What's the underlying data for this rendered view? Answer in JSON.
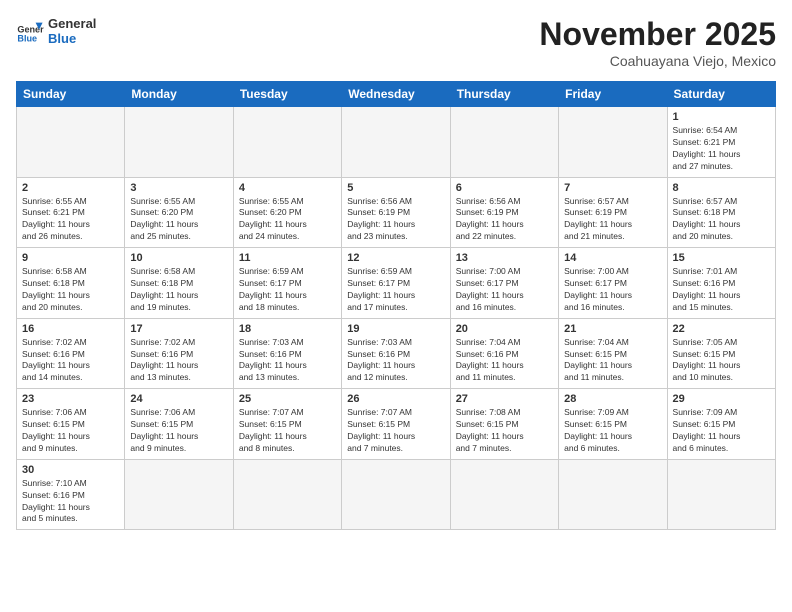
{
  "header": {
    "logo_general": "General",
    "logo_blue": "Blue",
    "month_title": "November 2025",
    "location": "Coahuayana Viejo, Mexico"
  },
  "days_of_week": [
    "Sunday",
    "Monday",
    "Tuesday",
    "Wednesday",
    "Thursday",
    "Friday",
    "Saturday"
  ],
  "weeks": [
    [
      {
        "day": "",
        "info": ""
      },
      {
        "day": "",
        "info": ""
      },
      {
        "day": "",
        "info": ""
      },
      {
        "day": "",
        "info": ""
      },
      {
        "day": "",
        "info": ""
      },
      {
        "day": "",
        "info": ""
      },
      {
        "day": "1",
        "info": "Sunrise: 6:54 AM\nSunset: 6:21 PM\nDaylight: 11 hours\nand 27 minutes."
      }
    ],
    [
      {
        "day": "2",
        "info": "Sunrise: 6:55 AM\nSunset: 6:21 PM\nDaylight: 11 hours\nand 26 minutes."
      },
      {
        "day": "3",
        "info": "Sunrise: 6:55 AM\nSunset: 6:20 PM\nDaylight: 11 hours\nand 25 minutes."
      },
      {
        "day": "4",
        "info": "Sunrise: 6:55 AM\nSunset: 6:20 PM\nDaylight: 11 hours\nand 24 minutes."
      },
      {
        "day": "5",
        "info": "Sunrise: 6:56 AM\nSunset: 6:19 PM\nDaylight: 11 hours\nand 23 minutes."
      },
      {
        "day": "6",
        "info": "Sunrise: 6:56 AM\nSunset: 6:19 PM\nDaylight: 11 hours\nand 22 minutes."
      },
      {
        "day": "7",
        "info": "Sunrise: 6:57 AM\nSunset: 6:19 PM\nDaylight: 11 hours\nand 21 minutes."
      },
      {
        "day": "8",
        "info": "Sunrise: 6:57 AM\nSunset: 6:18 PM\nDaylight: 11 hours\nand 20 minutes."
      }
    ],
    [
      {
        "day": "9",
        "info": "Sunrise: 6:58 AM\nSunset: 6:18 PM\nDaylight: 11 hours\nand 20 minutes."
      },
      {
        "day": "10",
        "info": "Sunrise: 6:58 AM\nSunset: 6:18 PM\nDaylight: 11 hours\nand 19 minutes."
      },
      {
        "day": "11",
        "info": "Sunrise: 6:59 AM\nSunset: 6:17 PM\nDaylight: 11 hours\nand 18 minutes."
      },
      {
        "day": "12",
        "info": "Sunrise: 6:59 AM\nSunset: 6:17 PM\nDaylight: 11 hours\nand 17 minutes."
      },
      {
        "day": "13",
        "info": "Sunrise: 7:00 AM\nSunset: 6:17 PM\nDaylight: 11 hours\nand 16 minutes."
      },
      {
        "day": "14",
        "info": "Sunrise: 7:00 AM\nSunset: 6:17 PM\nDaylight: 11 hours\nand 16 minutes."
      },
      {
        "day": "15",
        "info": "Sunrise: 7:01 AM\nSunset: 6:16 PM\nDaylight: 11 hours\nand 15 minutes."
      }
    ],
    [
      {
        "day": "16",
        "info": "Sunrise: 7:02 AM\nSunset: 6:16 PM\nDaylight: 11 hours\nand 14 minutes."
      },
      {
        "day": "17",
        "info": "Sunrise: 7:02 AM\nSunset: 6:16 PM\nDaylight: 11 hours\nand 13 minutes."
      },
      {
        "day": "18",
        "info": "Sunrise: 7:03 AM\nSunset: 6:16 PM\nDaylight: 11 hours\nand 13 minutes."
      },
      {
        "day": "19",
        "info": "Sunrise: 7:03 AM\nSunset: 6:16 PM\nDaylight: 11 hours\nand 12 minutes."
      },
      {
        "day": "20",
        "info": "Sunrise: 7:04 AM\nSunset: 6:16 PM\nDaylight: 11 hours\nand 11 minutes."
      },
      {
        "day": "21",
        "info": "Sunrise: 7:04 AM\nSunset: 6:15 PM\nDaylight: 11 hours\nand 11 minutes."
      },
      {
        "day": "22",
        "info": "Sunrise: 7:05 AM\nSunset: 6:15 PM\nDaylight: 11 hours\nand 10 minutes."
      }
    ],
    [
      {
        "day": "23",
        "info": "Sunrise: 7:06 AM\nSunset: 6:15 PM\nDaylight: 11 hours\nand 9 minutes."
      },
      {
        "day": "24",
        "info": "Sunrise: 7:06 AM\nSunset: 6:15 PM\nDaylight: 11 hours\nand 9 minutes."
      },
      {
        "day": "25",
        "info": "Sunrise: 7:07 AM\nSunset: 6:15 PM\nDaylight: 11 hours\nand 8 minutes."
      },
      {
        "day": "26",
        "info": "Sunrise: 7:07 AM\nSunset: 6:15 PM\nDaylight: 11 hours\nand 7 minutes."
      },
      {
        "day": "27",
        "info": "Sunrise: 7:08 AM\nSunset: 6:15 PM\nDaylight: 11 hours\nand 7 minutes."
      },
      {
        "day": "28",
        "info": "Sunrise: 7:09 AM\nSunset: 6:15 PM\nDaylight: 11 hours\nand 6 minutes."
      },
      {
        "day": "29",
        "info": "Sunrise: 7:09 AM\nSunset: 6:15 PM\nDaylight: 11 hours\nand 6 minutes."
      }
    ],
    [
      {
        "day": "30",
        "info": "Sunrise: 7:10 AM\nSunset: 6:16 PM\nDaylight: 11 hours\nand 5 minutes."
      },
      {
        "day": "",
        "info": ""
      },
      {
        "day": "",
        "info": ""
      },
      {
        "day": "",
        "info": ""
      },
      {
        "day": "",
        "info": ""
      },
      {
        "day": "",
        "info": ""
      },
      {
        "day": "",
        "info": ""
      }
    ]
  ]
}
